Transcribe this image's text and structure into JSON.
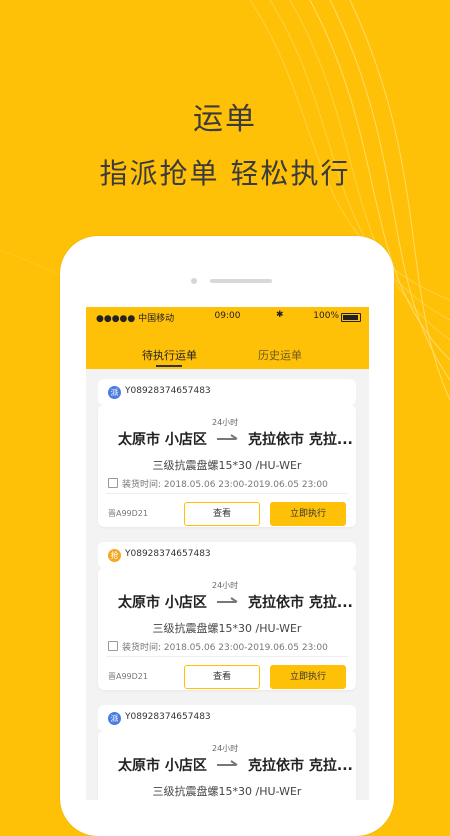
{
  "promo": {
    "title": "运单",
    "subtitle": "指派抢单   轻松执行"
  },
  "status_bar": {
    "carrier": "●●●●● 中国移动",
    "time": "09:00",
    "bluetooth": "✱",
    "battery": "100%"
  },
  "tabs": [
    {
      "label": "待执行运单"
    },
    {
      "label": "历史运单"
    }
  ],
  "orders": [
    {
      "badge": "派",
      "order_id": "Y08928374657483",
      "duration": "24小时",
      "origin": "太原市 小店区",
      "destination": "克拉依市 克拉...",
      "cargo": "三级抗震盘螺15*30 /HU-WEr",
      "load_time": "装货时间: 2018.05.06 23:00-2019.06.05 23:00",
      "plate": "晋A99D21",
      "view_label": "查看",
      "exec_label": "立即执行"
    },
    {
      "badge": "抢",
      "order_id": "Y08928374657483",
      "duration": "24小时",
      "origin": "太原市 小店区",
      "destination": "克拉依市 克拉...",
      "cargo": "三级抗震盘螺15*30 /HU-WEr",
      "load_time": "装货时间: 2018.05.06 23:00-2019.06.05 23:00",
      "plate": "晋A99D21",
      "view_label": "查看",
      "exec_label": "立即执行"
    },
    {
      "badge": "派",
      "order_id": "Y08928374657483",
      "duration": "24小时",
      "origin": "太原市 小店区",
      "destination": "克拉依市 克拉...",
      "cargo": "三级抗震盘螺15*30 /HU-WEr",
      "load_time": "",
      "plate": "",
      "view_label": "",
      "exec_label": ""
    }
  ],
  "colors": {
    "brand_yellow": "#FFC107",
    "badge_dispatch": "#4a7be0",
    "badge_grab": "#f5a623"
  }
}
